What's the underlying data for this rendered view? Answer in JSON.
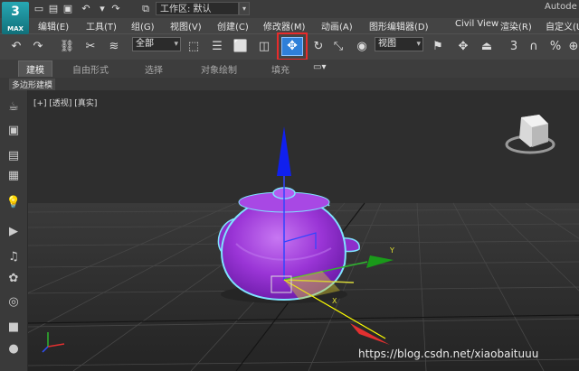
{
  "app": {
    "logo_text": "MAX",
    "workspace_label": "工作区: 默认",
    "title_right": "Autode"
  },
  "menu": [
    "编辑(E)",
    "工具(T)",
    "组(G)",
    "视图(V)",
    "创建(C)",
    "修改器(M)",
    "动画(A)",
    "图形编辑器(D)",
    "Civil View",
    "渲染(R)",
    "自定义(U"
  ],
  "toolbar": {
    "selection_filter": "全部",
    "reference_coord": "视图",
    "highlight_color": "#e82b2b"
  },
  "ribbon": {
    "tabs": [
      "建模",
      "自由形式",
      "选择",
      "对象绘制",
      "填充"
    ],
    "active_tab": "建模",
    "sub_tab": "多边形建模"
  },
  "viewport": {
    "label": "[+] [透视] [真实]",
    "object_color": "#9a35d6",
    "selection_outline": "#7fe3ff",
    "axis_colors": {
      "x": "#e23030",
      "y": "#2fb52f",
      "z": "#2030e0"
    }
  },
  "watermark": "https://blog.csdn.net/xiaobaituuu"
}
